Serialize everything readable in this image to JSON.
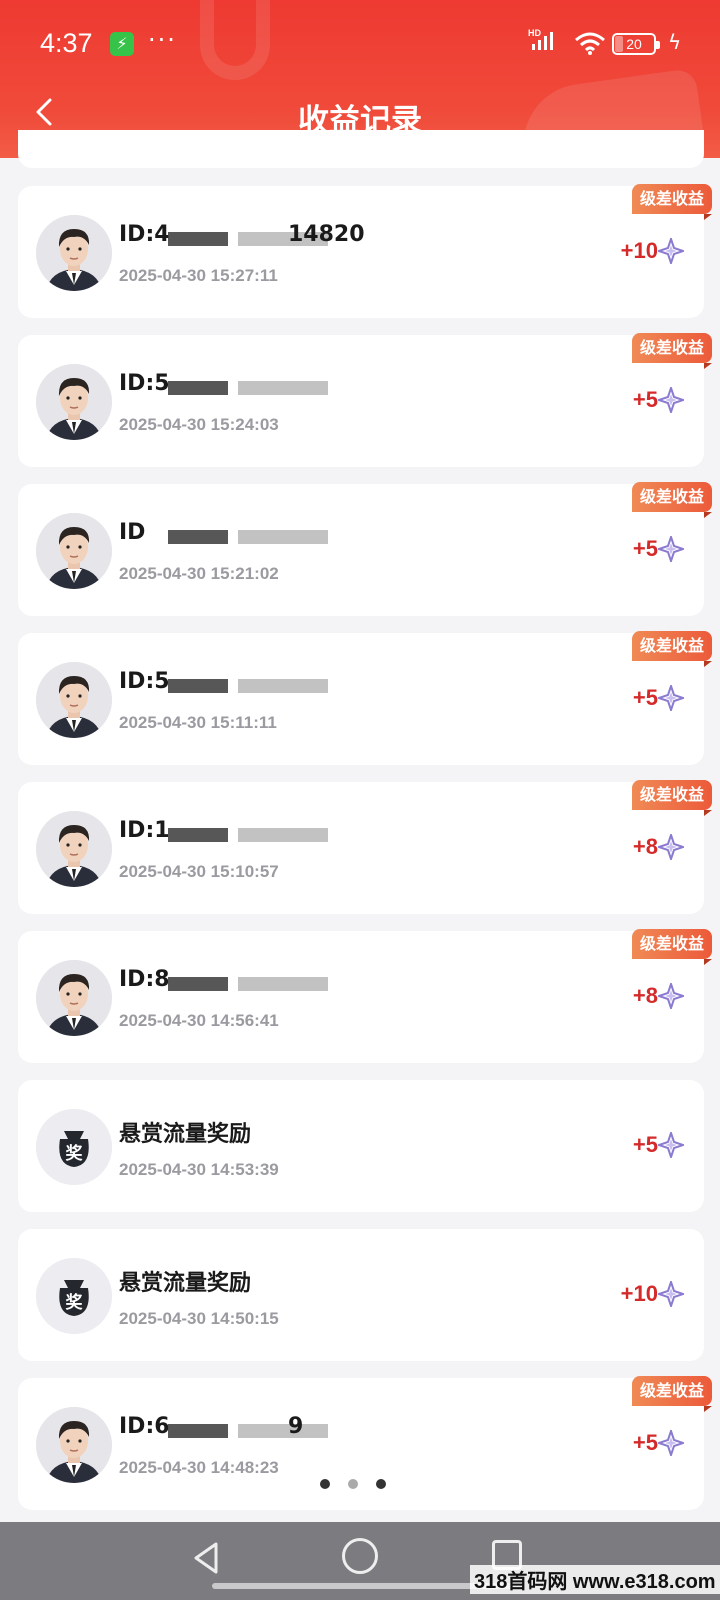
{
  "status_bar": {
    "time": "4:37",
    "dots": "···",
    "battery": "20"
  },
  "header": {
    "title": "收益记录"
  },
  "tag_label": "级差收益",
  "records": [
    {
      "kind": "user",
      "name": "ID:4",
      "name_tail": "14820",
      "date": "2025-04-30 15:27:11",
      "amount": "+10",
      "tag": true
    },
    {
      "kind": "user",
      "name": "ID:5",
      "name_tail": "",
      "date": "2025-04-30 15:24:03",
      "amount": "+5",
      "tag": true
    },
    {
      "kind": "user",
      "name": "ID",
      "name_tail": "",
      "date": "2025-04-30 15:21:02",
      "amount": "+5",
      "tag": true
    },
    {
      "kind": "user",
      "name": "ID:5",
      "name_tail": "",
      "date": "2025-04-30 15:11:11",
      "amount": "+5",
      "tag": true
    },
    {
      "kind": "user",
      "name": "ID:1",
      "name_tail": "",
      "date": "2025-04-30 15:10:57",
      "amount": "+8",
      "tag": true
    },
    {
      "kind": "user",
      "name": "ID:8",
      "name_tail": "",
      "date": "2025-04-30 14:56:41",
      "amount": "+8",
      "tag": true
    },
    {
      "kind": "reward",
      "name": "悬赏流量奖励",
      "badge": "奖",
      "date": "2025-04-30 14:53:39",
      "amount": "+5",
      "tag": false
    },
    {
      "kind": "reward",
      "name": "悬赏流量奖励",
      "badge": "奖",
      "date": "2025-04-30 14:50:15",
      "amount": "+10",
      "tag": false
    },
    {
      "kind": "user",
      "name": "ID:6",
      "name_tail": "9",
      "date": "2025-04-30 14:48:23",
      "amount": "+5",
      "tag": true
    }
  ],
  "watermark": "318首码网 www.e318.com",
  "colors": {
    "header": "#ee3a32",
    "amount": "#d42a2a",
    "tag": "#ec5a3a",
    "star": "#8a7ad0"
  }
}
